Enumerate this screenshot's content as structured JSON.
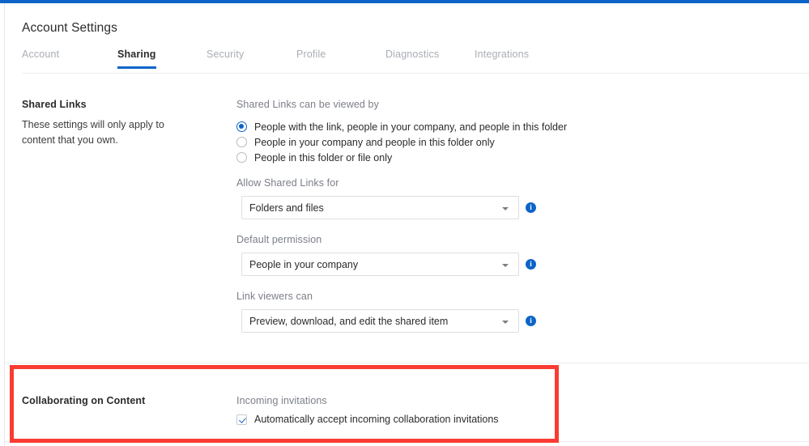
{
  "window": {
    "title": "Account Settings",
    "accent_color": "#0c64c8",
    "highlight_color": "#fa3c32"
  },
  "tabs": [
    {
      "label": "Account",
      "active": false
    },
    {
      "label": "Sharing",
      "active": true
    },
    {
      "label": "Security",
      "active": false
    },
    {
      "label": "Profile",
      "active": false
    },
    {
      "label": "Diagnostics",
      "active": false
    },
    {
      "label": "Integrations",
      "active": false
    }
  ],
  "shared_links": {
    "section_label": "Shared Links",
    "section_desc": "These settings will only apply to content that you own.",
    "viewed_by": {
      "label": "Shared Links can be viewed by",
      "options": [
        "People with the link, people in your company, and people in this folder",
        "People in your company and people in this folder only",
        "People in this folder or file only"
      ],
      "selected_index": 0
    },
    "allow_for": {
      "label": "Allow Shared Links for",
      "value": "Folders and files",
      "info_icon": "info-icon"
    },
    "default_permission": {
      "label": "Default permission",
      "value": "People in your company",
      "info_icon": "info-icon"
    },
    "link_viewers": {
      "label": "Link viewers can",
      "value": "Preview, download, and edit the shared item",
      "info_icon": "info-icon"
    }
  },
  "collaborating": {
    "section_label": "Collaborating on Content",
    "incoming": {
      "label": "Incoming invitations",
      "checkbox_label": "Automatically accept incoming collaboration invitations",
      "checked": true
    }
  }
}
